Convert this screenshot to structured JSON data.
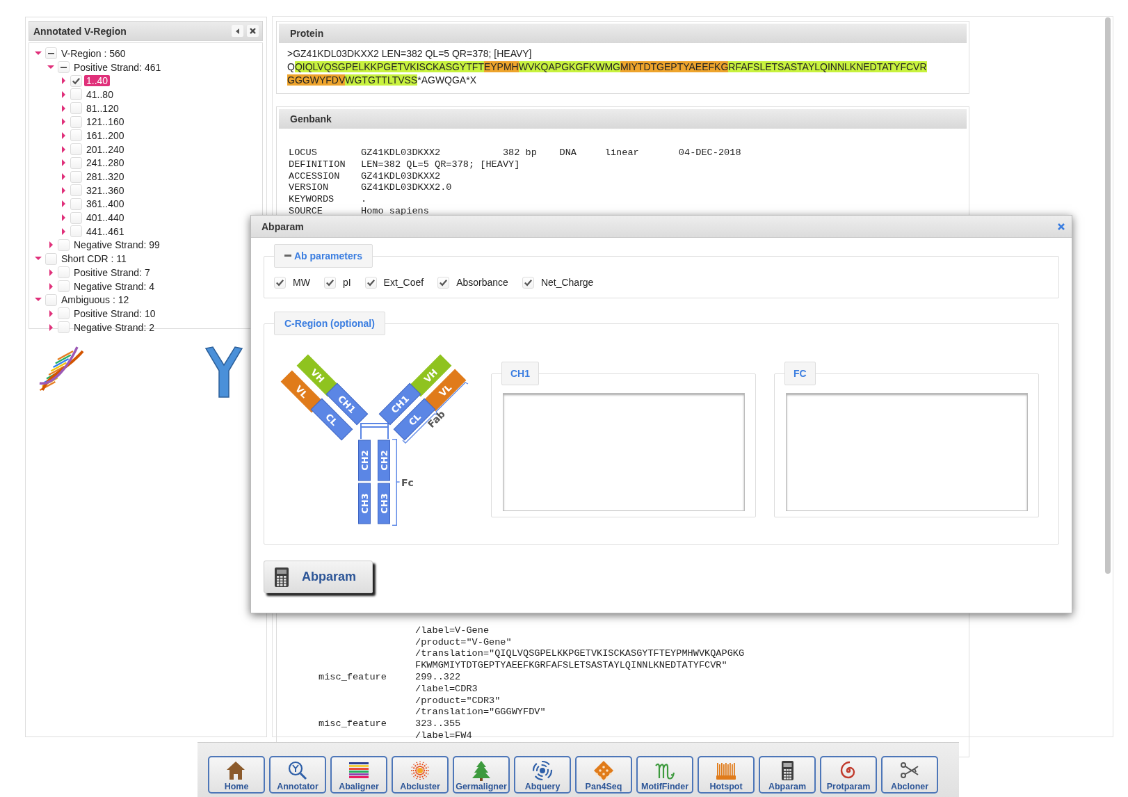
{
  "left_panel": {
    "title": "Annotated V-Region",
    "tree": [
      {
        "label": "V-Region : 560",
        "expanded": true,
        "checked": true,
        "partial": true,
        "selected": false,
        "children": [
          {
            "label": "Positive Strand: 461",
            "expanded": true,
            "checked": true,
            "partial": true,
            "selected": false,
            "children": [
              {
                "label": "1..40",
                "expanded": false,
                "checked": true,
                "partial": false,
                "selected": true
              },
              {
                "label": "41..80",
                "expanded": false,
                "checked": false,
                "partial": false,
                "selected": false
              },
              {
                "label": "81..120",
                "expanded": false,
                "checked": false,
                "partial": false,
                "selected": false
              },
              {
                "label": "121..160",
                "expanded": false,
                "checked": false,
                "partial": false,
                "selected": false
              },
              {
                "label": "161..200",
                "expanded": false,
                "checked": false,
                "partial": false,
                "selected": false
              },
              {
                "label": "201..240",
                "expanded": false,
                "checked": false,
                "partial": false,
                "selected": false
              },
              {
                "label": "241..280",
                "expanded": false,
                "checked": false,
                "partial": false,
                "selected": false
              },
              {
                "label": "281..320",
                "expanded": false,
                "checked": false,
                "partial": false,
                "selected": false
              },
              {
                "label": "321..360",
                "expanded": false,
                "checked": false,
                "partial": false,
                "selected": false
              },
              {
                "label": "361..400",
                "expanded": false,
                "checked": false,
                "partial": false,
                "selected": false
              },
              {
                "label": "401..440",
                "expanded": false,
                "checked": false,
                "partial": false,
                "selected": false
              },
              {
                "label": "441..461",
                "expanded": false,
                "checked": false,
                "partial": false,
                "selected": false
              }
            ]
          },
          {
            "label": "Negative Strand: 99",
            "expanded": false,
            "checked": false,
            "partial": false,
            "selected": false
          }
        ]
      },
      {
        "label": "Short CDR : 11",
        "expanded": true,
        "checked": false,
        "partial": false,
        "selected": false,
        "children": [
          {
            "label": "Positive Strand: 7",
            "expanded": false,
            "checked": false,
            "partial": false,
            "selected": false
          },
          {
            "label": "Negative Strand: 4",
            "expanded": false,
            "checked": false,
            "partial": false,
            "selected": false
          }
        ]
      },
      {
        "label": "Ambiguous : 12",
        "expanded": true,
        "checked": false,
        "partial": false,
        "selected": false,
        "children": [
          {
            "label": "Positive Strand: 10",
            "expanded": false,
            "checked": false,
            "partial": false,
            "selected": false
          },
          {
            "label": "Negative Strand: 2",
            "expanded": false,
            "checked": false,
            "partial": false,
            "selected": false
          }
        ]
      }
    ]
  },
  "protein": {
    "title": "Protein",
    "header": ">GZ41KDL03DKXX2 LEN=382 QL=5 QR=378; [HEAVY]",
    "segments": [
      {
        "text": "Q",
        "kind": "plain"
      },
      {
        "text": "QIQLVQSGPELKKPGETVKISCKASGYTFT",
        "kind": "framework"
      },
      {
        "text": "EYPMH",
        "kind": "cdr"
      },
      {
        "text": "WVKQAPGKGFKWMG",
        "kind": "framework"
      },
      {
        "text": "MIYTDTGEPTYAEEFKG",
        "kind": "cdr"
      },
      {
        "text": "RFAFSLETSASTAYLQINNLKNEDTATYFCVR",
        "kind": "framework"
      },
      {
        "text": "GGGWYFDV",
        "kind": "cdr"
      },
      {
        "text": "WGTGTTLTVSS",
        "kind": "framework"
      },
      {
        "text": "*AGWQGA*X",
        "kind": "plain"
      }
    ]
  },
  "genbank": {
    "title": "Genbank",
    "lines_top": [
      {
        "key": "LOCUS",
        "value": "GZ41KDL03DKXX2           382 bp    DNA     linear       04-DEC-2018"
      },
      {
        "key": "DEFINITION",
        "value": "LEN=382 QL=5 QR=378; [HEAVY]"
      },
      {
        "key": "ACCESSION",
        "value": "GZ41KDL03DKXX2"
      },
      {
        "key": "VERSION",
        "value": "GZ41KDL03DKXX2.0"
      },
      {
        "key": "KEYWORDS",
        "value": "."
      },
      {
        "key": "SOURCE",
        "value": "Homo sapiens"
      }
    ],
    "lines_bottom": [
      {
        "value": "/label=V-Gene"
      },
      {
        "value": "/product=\"V-Gene\""
      },
      {
        "value": "/translation=\"QIQLVQSGPELKKPGETVKISCKASGYTFTEYPMHWVKQAPGKG"
      },
      {
        "value": "FKWMGMIYTDTGEPTYAEEFKGRFAFSLETSASTAYLQINNLKNEDTATYFCVR\""
      },
      {
        "key": "misc_feature",
        "value": "299..322"
      },
      {
        "value": "/label=CDR3"
      },
      {
        "value": "/product=\"CDR3\""
      },
      {
        "value": "/translation=\"GGGWYFDV\""
      },
      {
        "key": "misc_feature",
        "value": "323..355"
      },
      {
        "value": "/label=FW4"
      }
    ]
  },
  "dialog": {
    "title": "Abparam",
    "ab_parameters": {
      "legend": "Ab parameters",
      "expanded": true,
      "options": [
        {
          "label": "MW",
          "checked": true
        },
        {
          "label": "pI",
          "checked": true
        },
        {
          "label": "Ext_Coef",
          "checked": true
        },
        {
          "label": "Absorbance",
          "checked": true
        },
        {
          "label": "Net_Charge",
          "checked": true
        }
      ]
    },
    "c_region": {
      "legend": "C-Region (optional)",
      "diagram": {
        "domains": [
          {
            "label": "VL",
            "kind": "light-variable"
          },
          {
            "label": "VH",
            "kind": "heavy-variable"
          },
          {
            "label": "CL",
            "kind": "constant"
          },
          {
            "label": "CH1",
            "kind": "constant"
          },
          {
            "label": "VH",
            "kind": "heavy-variable"
          },
          {
            "label": "VL",
            "kind": "light-variable"
          },
          {
            "label": "CH1",
            "kind": "constant"
          },
          {
            "label": "CL",
            "kind": "constant"
          },
          {
            "label": "CH2",
            "kind": "constant"
          },
          {
            "label": "CH2",
            "kind": "constant"
          },
          {
            "label": "CH3",
            "kind": "constant"
          },
          {
            "label": "CH3",
            "kind": "constant"
          }
        ],
        "fab_label": "Fab",
        "fc_label": "Fc"
      },
      "inputs": [
        {
          "legend": "CH1"
        },
        {
          "legend": "FC"
        }
      ]
    },
    "button": "Abparam"
  },
  "dock": [
    {
      "label": "Home"
    },
    {
      "label": "Annotator"
    },
    {
      "label": "Abaligner"
    },
    {
      "label": "Abcluster"
    },
    {
      "label": "Germaligner"
    },
    {
      "label": "Abquery"
    },
    {
      "label": "Pan4Seq"
    },
    {
      "label": "MotifFinder"
    },
    {
      "label": "Hotspot"
    },
    {
      "label": "Abparam"
    },
    {
      "label": "Protparam"
    },
    {
      "label": "Abcloner"
    }
  ]
}
